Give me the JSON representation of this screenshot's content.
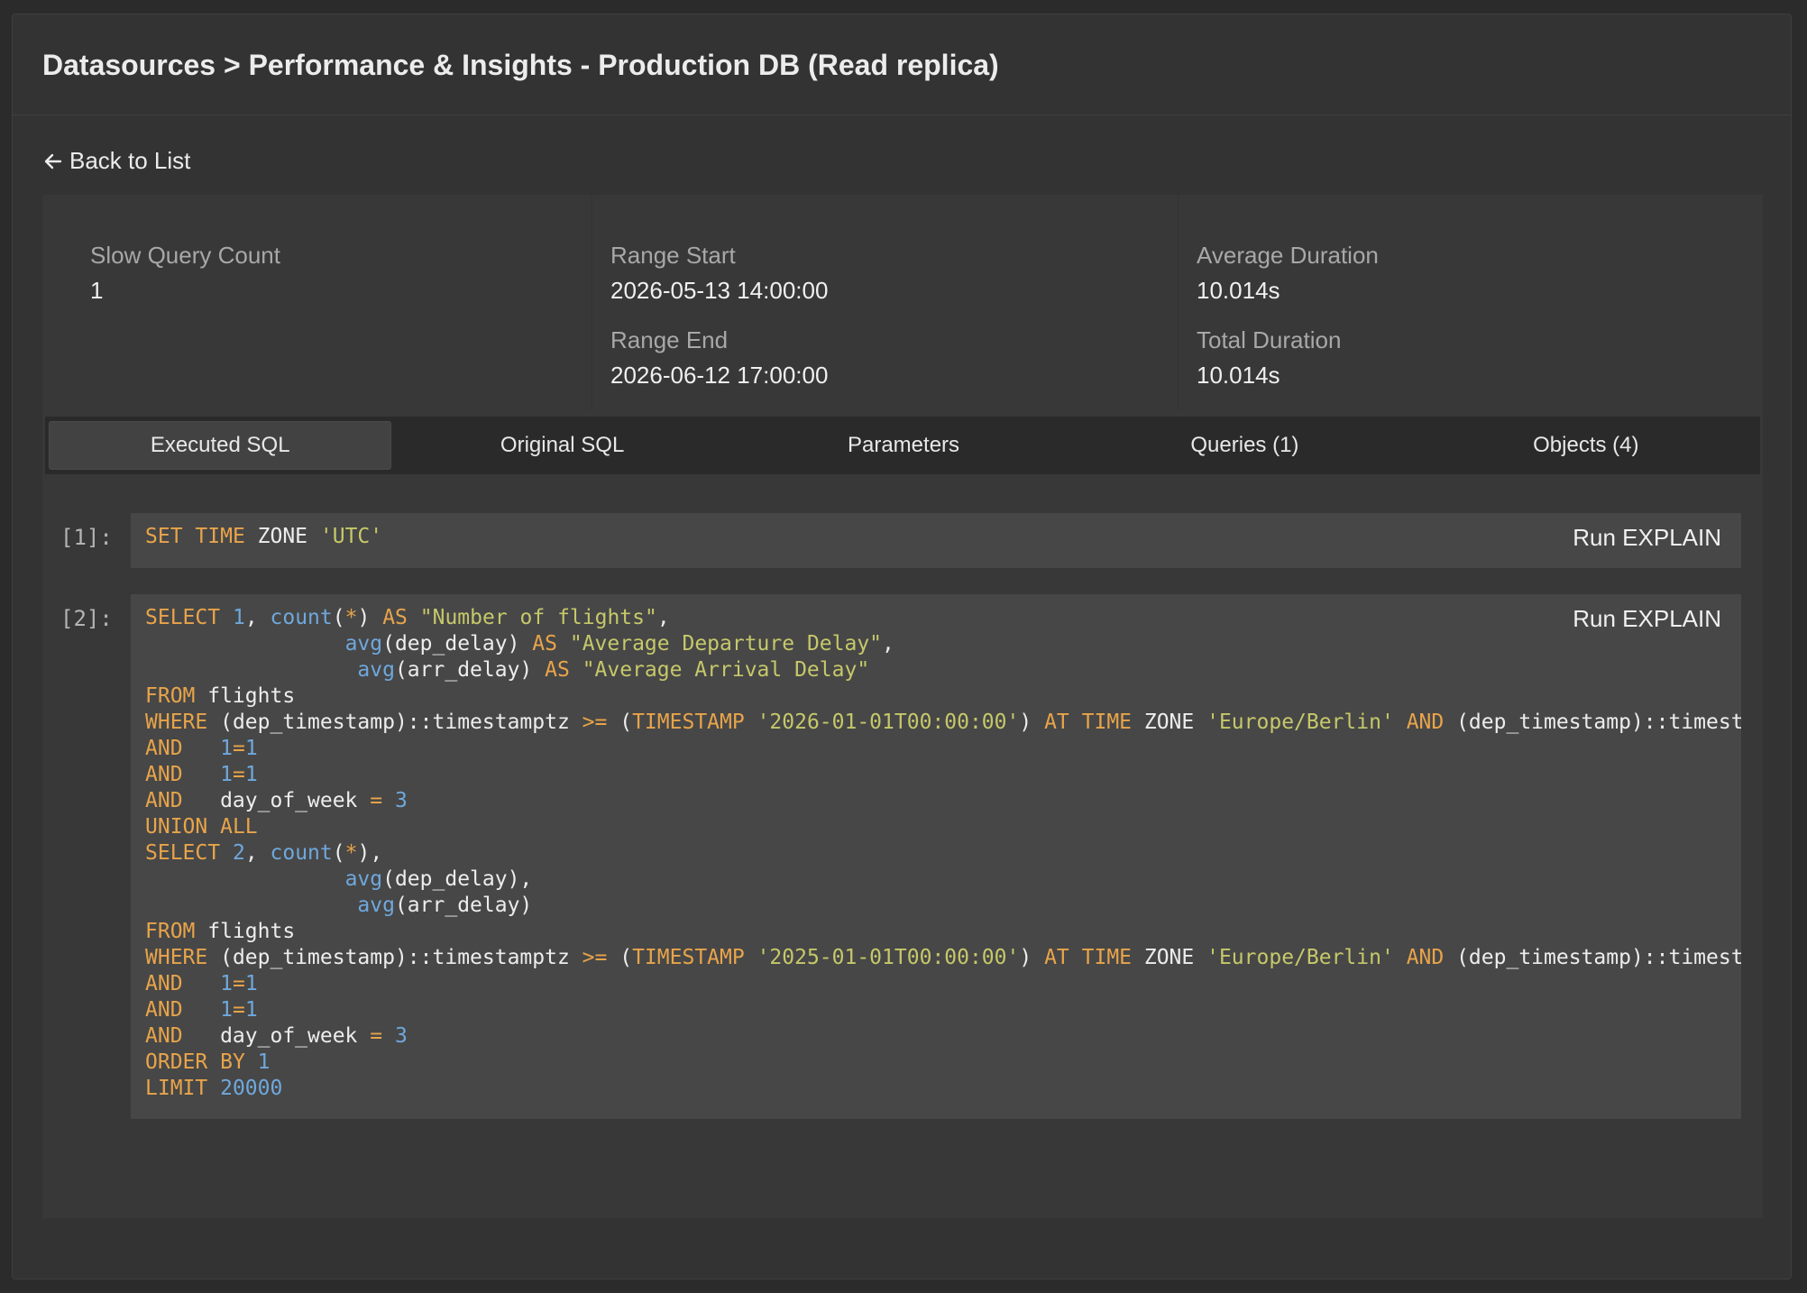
{
  "header": {
    "breadcrumb": "Datasources > Performance & Insights - Production DB (Read replica)"
  },
  "nav": {
    "back_label": "Back to List",
    "back_icon": "arrow-left-icon"
  },
  "stats": {
    "slow_query_count": {
      "label": "Slow Query Count",
      "value": "1"
    },
    "range_start": {
      "label": "Range Start",
      "value": "2026-05-13 14:00:00"
    },
    "range_end": {
      "label": "Range End",
      "value": "2026-06-12 17:00:00"
    },
    "average_duration": {
      "label": "Average Duration",
      "value": "10.014s"
    },
    "total_duration": {
      "label": "Total Duration",
      "value": "10.014s"
    }
  },
  "tabs": [
    {
      "label": "Executed SQL",
      "active": true
    },
    {
      "label": "Original SQL",
      "active": false
    },
    {
      "label": "Parameters",
      "active": false
    },
    {
      "label": "Queries (1)",
      "active": false
    },
    {
      "label": "Objects (4)",
      "active": false
    }
  ],
  "statements": [
    {
      "index": "[1]:",
      "run_label": "Run EXPLAIN",
      "lines": [
        "SET TIME ZONE 'UTC'"
      ]
    },
    {
      "index": "[2]:",
      "run_label": "Run EXPLAIN",
      "lines": [
        "SELECT 1, count(*) AS \"Number of flights\",",
        "                avg(dep_delay) AS \"Average Departure Delay\",",
        "                 avg(arr_delay) AS \"Average Arrival Delay\"",
        "FROM flights",
        "WHERE (dep_timestamp)::timestamptz >= (TIMESTAMP '2026-01-01T00:00:00') AT TIME ZONE 'Europe/Berlin' AND (dep_timestamp)::timestamptz",
        "AND   1=1",
        "AND   1=1",
        "AND   day_of_week = 3",
        "UNION ALL",
        "SELECT 2, count(*),",
        "                avg(dep_delay),",
        "                 avg(arr_delay)",
        "FROM flights",
        "WHERE (dep_timestamp)::timestamptz >= (TIMESTAMP '2025-01-01T00:00:00') AT TIME ZONE 'Europe/Berlin' AND (dep_timestamp)::timestamptz",
        "AND   1=1",
        "AND   1=1",
        "AND   day_of_week = 3",
        "ORDER BY 1",
        "LIMIT 20000"
      ]
    }
  ],
  "colors": {
    "keyword": "#e8a44a",
    "function": "#6fa8dc",
    "number": "#6fa8dc",
    "string": "#c6c86a"
  }
}
